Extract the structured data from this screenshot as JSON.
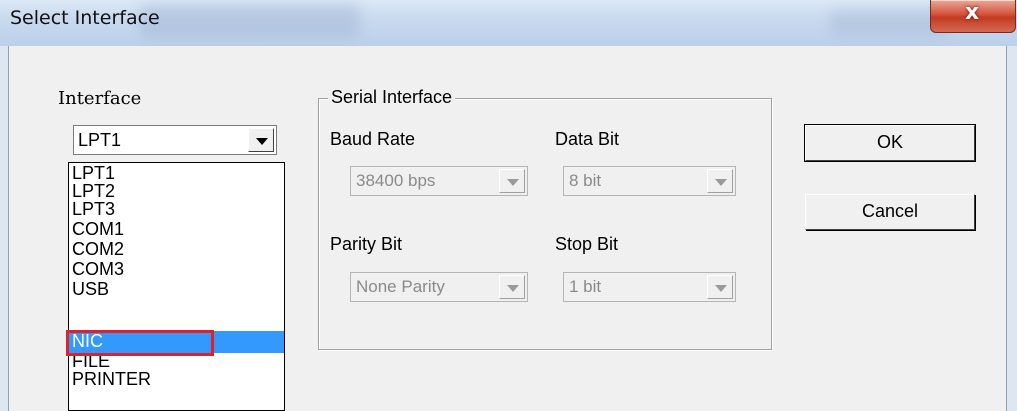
{
  "window": {
    "title": "Select Interface",
    "close_label": "x"
  },
  "interface": {
    "label": "Interface",
    "selected_value": "LPT1",
    "options": [
      "LPT1",
      "LPT2",
      "LPT3",
      "COM1",
      "COM2",
      "COM3",
      "USB",
      "NIC",
      "FILE",
      "PRINTER"
    ],
    "highlighted_option": "NIC"
  },
  "serial": {
    "group_title": "Serial Interface",
    "baud_rate": {
      "label": "Baud Rate",
      "value": "38400 bps"
    },
    "data_bit": {
      "label": "Data Bit",
      "value": "8 bit"
    },
    "parity_bit": {
      "label": "Parity Bit",
      "value": "None Parity"
    },
    "stop_bit": {
      "label": "Stop Bit",
      "value": "1 bit"
    }
  },
  "buttons": {
    "ok": "OK",
    "cancel": "Cancel"
  },
  "colors": {
    "selection": "#3399ff",
    "annotation_box": "#e0202a",
    "close_button": "#c33a22"
  }
}
